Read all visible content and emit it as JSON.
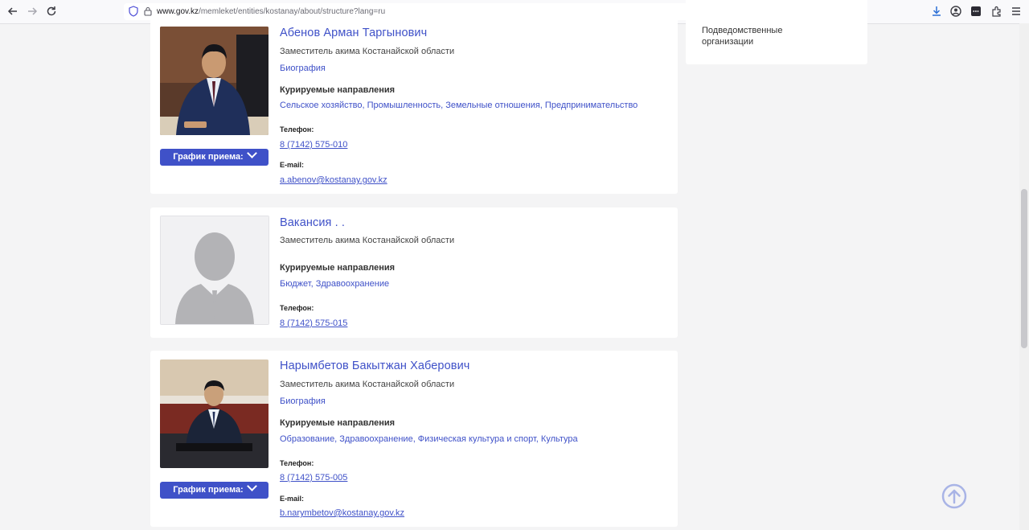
{
  "browser": {
    "url_host": "www.gov.kz",
    "url_path": "/memleket/entities/kostanay/about/structure?lang=ru"
  },
  "sidebar": {
    "item_label": "Подведомственные организации"
  },
  "people": [
    {
      "name": "Абенов Арман Таргынович",
      "position": "Заместитель акима Костанайской области",
      "bio_link": "Биография",
      "directions_label": "Курируемые направления",
      "directions": "Сельское хозяйство, Промышленность, Земельные отношения, Предпринимательство",
      "phone_label": "Телефон:",
      "phone": "8 (7142) 575-010",
      "email_label": "E-mail:",
      "email": "a.abenov@kostanay.gov.kz",
      "schedule_button": "График приема:"
    },
    {
      "name": "Вакансия . .",
      "position": "Заместитель акима Костанайской области",
      "directions_label": "Курируемые направления",
      "directions": "Бюджет, Здравоохранение",
      "phone_label": "Телефон:",
      "phone": "8 (7142) 575-015"
    },
    {
      "name": "Нарымбетов Бакытжан Хаберович",
      "position": "Заместитель акима Костанайской области",
      "bio_link": "Биография",
      "directions_label": "Курируемые направления",
      "directions": "Образование, Здравоохранение, Физическая культура и спорт, Культура",
      "phone_label": "Телефон:",
      "phone": "8 (7142) 575-005",
      "email_label": "E-mail:",
      "email": "b.narymbetov@kostanay.gov.kz",
      "schedule_button": "График приема:"
    }
  ],
  "colors": {
    "accent": "#3f51c8",
    "background": "#f4f4f5"
  }
}
